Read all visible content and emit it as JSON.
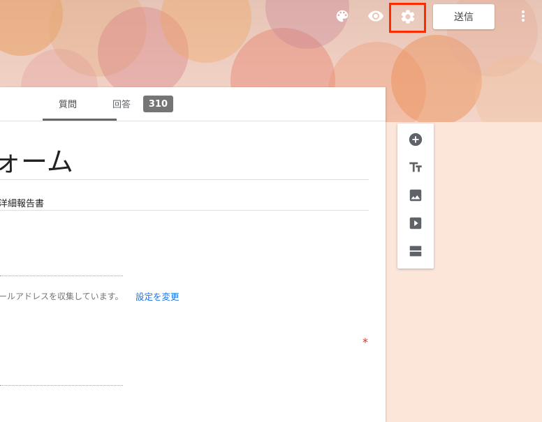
{
  "topbar": {
    "send_label": "送信",
    "icons": [
      "palette-icon",
      "eye-icon",
      "gear-icon",
      "more-vert-icon"
    ],
    "highlight_color": "#ff2a00"
  },
  "tabs": {
    "questions_label": "質問",
    "responses_label": "回答",
    "responses_count": "310"
  },
  "form": {
    "title": "ォーム",
    "description": "洋細報告書",
    "email_note": "ールアドレスを収集しています。",
    "change_settings_link": "設定を変更",
    "required_mark": "*"
  },
  "side_toolbar": {
    "items": [
      "add-question-icon",
      "add-title-icon",
      "add-image-icon",
      "add-video-icon",
      "add-section-icon"
    ]
  },
  "colors": {
    "link": "#1a73e8",
    "required": "#d93025",
    "page_background": "#fce5d9"
  }
}
